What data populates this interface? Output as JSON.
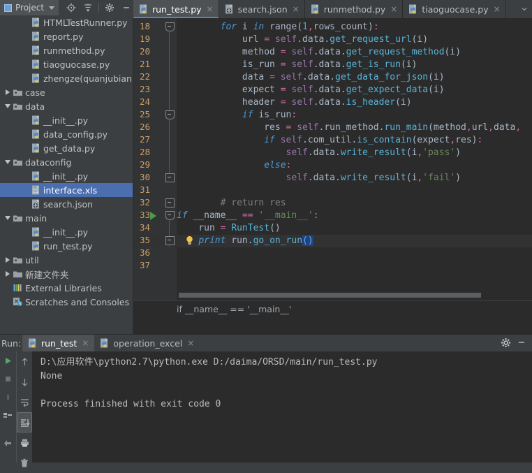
{
  "toolbar": {
    "project_label": "Project",
    "icons": [
      "project-panel-icon",
      "dropdown-caret-icon",
      "locate-target-icon",
      "collapse-all-icon",
      "settings-gear-icon",
      "hide-panel-icon"
    ]
  },
  "tree": {
    "items": [
      {
        "label": "HTMLTestRunner.py",
        "icon": "python-file-icon",
        "indent": 2,
        "arrow": "none",
        "selected": false
      },
      {
        "label": "report.py",
        "icon": "python-file-icon",
        "indent": 2,
        "arrow": "none",
        "selected": false
      },
      {
        "label": "runmethod.py",
        "icon": "python-file-icon",
        "indent": 2,
        "arrow": "none",
        "selected": false
      },
      {
        "label": "tiaoguocase.py",
        "icon": "python-file-icon",
        "indent": 2,
        "arrow": "none",
        "selected": false
      },
      {
        "label": "zhengze(quanjubianliar",
        "icon": "python-file-icon",
        "indent": 2,
        "arrow": "none",
        "selected": false
      },
      {
        "label": "case",
        "icon": "folder-icon",
        "indent": 0,
        "arrow": "closed",
        "selected": false
      },
      {
        "label": "data",
        "icon": "folder-icon",
        "indent": 0,
        "arrow": "open",
        "selected": false
      },
      {
        "label": "__init__.py",
        "icon": "python-file-icon",
        "indent": 2,
        "arrow": "none",
        "selected": false
      },
      {
        "label": "data_config.py",
        "icon": "python-file-icon",
        "indent": 2,
        "arrow": "none",
        "selected": false
      },
      {
        "label": "get_data.py",
        "icon": "python-file-icon",
        "indent": 2,
        "arrow": "none",
        "selected": false
      },
      {
        "label": "dataconfig",
        "icon": "folder-icon",
        "indent": 0,
        "arrow": "open",
        "selected": false
      },
      {
        "label": "__init__.py",
        "icon": "python-file-icon",
        "indent": 2,
        "arrow": "none",
        "selected": false
      },
      {
        "label": "interface.xls",
        "icon": "xls-file-icon",
        "indent": 2,
        "arrow": "none",
        "selected": true
      },
      {
        "label": "search.json",
        "icon": "json-file-icon",
        "indent": 2,
        "arrow": "none",
        "selected": false
      },
      {
        "label": "main",
        "icon": "folder-icon",
        "indent": 0,
        "arrow": "open",
        "selected": false
      },
      {
        "label": "__init__.py",
        "icon": "python-file-icon",
        "indent": 2,
        "arrow": "none",
        "selected": false
      },
      {
        "label": "run_test.py",
        "icon": "python-file-icon",
        "indent": 2,
        "arrow": "none",
        "selected": false
      },
      {
        "label": "util",
        "icon": "folder-icon",
        "indent": 0,
        "arrow": "closed",
        "selected": false
      },
      {
        "label": "新建文件夹",
        "icon": "folder-plain-icon",
        "indent": 0,
        "arrow": "closed",
        "selected": false
      },
      {
        "label": "External Libraries",
        "icon": "libraries-icon",
        "indent": 0,
        "arrow": "none",
        "selected": false
      },
      {
        "label": "Scratches and Consoles",
        "icon": "scratches-icon",
        "indent": 0,
        "arrow": "none",
        "selected": false
      }
    ]
  },
  "editor": {
    "tabs": [
      {
        "label": "run_test.py",
        "icon": "python-file-icon",
        "active": true
      },
      {
        "label": "search.json",
        "icon": "json-file-icon",
        "active": false
      },
      {
        "label": "runmethod.py",
        "icon": "python-file-icon",
        "active": false
      },
      {
        "label": "tiaoguocase.py",
        "icon": "python-file-icon",
        "active": false
      }
    ],
    "close_glyph": "×",
    "breadcrumb": "if __name__ == '__main__'",
    "first_line_number": 18,
    "last_line_number": 37,
    "current_line": 35,
    "lines": [
      {
        "n": 18,
        "tokens": [
          {
            "t": "        ",
            "c": "pl"
          },
          {
            "t": "for",
            "c": "kwi"
          },
          {
            "t": " i ",
            "c": "pl"
          },
          {
            "t": "in",
            "c": "kwi"
          },
          {
            "t": " range(",
            "c": "pl"
          },
          {
            "t": "1",
            "c": "num"
          },
          {
            "t": ",",
            "c": "op"
          },
          {
            "t": "rows_count",
            "c": "pl"
          },
          {
            "t": ")",
            "c": "pl"
          },
          {
            "t": ":",
            "c": "op"
          }
        ]
      },
      {
        "n": 19,
        "tokens": [
          {
            "t": "            url ",
            "c": "pl"
          },
          {
            "t": "=",
            "c": "op"
          },
          {
            "t": " ",
            "c": "pl"
          },
          {
            "t": "self",
            "c": "sf"
          },
          {
            "t": ".data.",
            "c": "pl"
          },
          {
            "t": "get_request_url",
            "c": "fn"
          },
          {
            "t": "(i)",
            "c": "pl"
          }
        ]
      },
      {
        "n": 20,
        "tokens": [
          {
            "t": "            method ",
            "c": "pl"
          },
          {
            "t": "=",
            "c": "op"
          },
          {
            "t": " ",
            "c": "pl"
          },
          {
            "t": "self",
            "c": "sf"
          },
          {
            "t": ".data.",
            "c": "pl"
          },
          {
            "t": "get_request_method",
            "c": "fn"
          },
          {
            "t": "(i)",
            "c": "pl"
          }
        ]
      },
      {
        "n": 21,
        "tokens": [
          {
            "t": "            is_run ",
            "c": "pl"
          },
          {
            "t": "=",
            "c": "op"
          },
          {
            "t": " ",
            "c": "pl"
          },
          {
            "t": "self",
            "c": "sf"
          },
          {
            "t": ".data.",
            "c": "pl"
          },
          {
            "t": "get_is_run",
            "c": "fn"
          },
          {
            "t": "(i)",
            "c": "pl"
          }
        ]
      },
      {
        "n": 22,
        "tokens": [
          {
            "t": "            data ",
            "c": "pl"
          },
          {
            "t": "=",
            "c": "op"
          },
          {
            "t": " ",
            "c": "pl"
          },
          {
            "t": "self",
            "c": "sf"
          },
          {
            "t": ".data.",
            "c": "pl"
          },
          {
            "t": "get_data_for_json",
            "c": "fn"
          },
          {
            "t": "(i)",
            "c": "pl"
          }
        ]
      },
      {
        "n": 23,
        "tokens": [
          {
            "t": "            expect ",
            "c": "pl"
          },
          {
            "t": "=",
            "c": "op"
          },
          {
            "t": " ",
            "c": "pl"
          },
          {
            "t": "self",
            "c": "sf"
          },
          {
            "t": ".data.",
            "c": "pl"
          },
          {
            "t": "get_expect_data",
            "c": "fn"
          },
          {
            "t": "(i)",
            "c": "pl"
          }
        ]
      },
      {
        "n": 24,
        "tokens": [
          {
            "t": "            header ",
            "c": "pl"
          },
          {
            "t": "=",
            "c": "op"
          },
          {
            "t": " ",
            "c": "pl"
          },
          {
            "t": "self",
            "c": "sf"
          },
          {
            "t": ".data.",
            "c": "pl"
          },
          {
            "t": "is_header",
            "c": "fn"
          },
          {
            "t": "(i)",
            "c": "pl"
          }
        ]
      },
      {
        "n": 25,
        "tokens": [
          {
            "t": "            ",
            "c": "pl"
          },
          {
            "t": "if",
            "c": "kwi"
          },
          {
            "t": " is_run",
            "c": "pl"
          },
          {
            "t": ":",
            "c": "op"
          }
        ]
      },
      {
        "n": 26,
        "tokens": [
          {
            "t": "                res ",
            "c": "pl"
          },
          {
            "t": "=",
            "c": "op"
          },
          {
            "t": " ",
            "c": "pl"
          },
          {
            "t": "self",
            "c": "sf"
          },
          {
            "t": ".run_method.",
            "c": "pl"
          },
          {
            "t": "run_main",
            "c": "fn"
          },
          {
            "t": "(method",
            "c": "pl"
          },
          {
            "t": ",",
            "c": "op"
          },
          {
            "t": "url",
            "c": "pl"
          },
          {
            "t": ",",
            "c": "op"
          },
          {
            "t": "data",
            "c": "pl"
          },
          {
            "t": ",",
            "c": "op"
          }
        ]
      },
      {
        "n": 27,
        "tokens": [
          {
            "t": "                ",
            "c": "pl"
          },
          {
            "t": "if",
            "c": "kwi"
          },
          {
            "t": " ",
            "c": "pl"
          },
          {
            "t": "self",
            "c": "sf"
          },
          {
            "t": ".com_util.",
            "c": "pl"
          },
          {
            "t": "is_contain",
            "c": "fn"
          },
          {
            "t": "(expect",
            "c": "pl"
          },
          {
            "t": ",",
            "c": "op"
          },
          {
            "t": "res)",
            "c": "pl"
          },
          {
            "t": ":",
            "c": "op"
          }
        ]
      },
      {
        "n": 28,
        "tokens": [
          {
            "t": "                    ",
            "c": "pl"
          },
          {
            "t": "self",
            "c": "sf"
          },
          {
            "t": ".data.",
            "c": "pl"
          },
          {
            "t": "write_result",
            "c": "fn"
          },
          {
            "t": "(i",
            "c": "pl"
          },
          {
            "t": ",",
            "c": "op"
          },
          {
            "t": "'pass'",
            "c": "str"
          },
          {
            "t": ")",
            "c": "pl"
          }
        ]
      },
      {
        "n": 29,
        "tokens": [
          {
            "t": "                ",
            "c": "pl"
          },
          {
            "t": "else",
            "c": "kwi"
          },
          {
            "t": ":",
            "c": "op"
          }
        ]
      },
      {
        "n": 30,
        "tokens": [
          {
            "t": "                    ",
            "c": "pl"
          },
          {
            "t": "self",
            "c": "sf"
          },
          {
            "t": ".data.",
            "c": "pl"
          },
          {
            "t": "write_result",
            "c": "fn"
          },
          {
            "t": "(i",
            "c": "pl"
          },
          {
            "t": ",",
            "c": "op"
          },
          {
            "t": "'fail'",
            "c": "str"
          },
          {
            "t": ")",
            "c": "pl"
          }
        ]
      },
      {
        "n": 31,
        "tokens": []
      },
      {
        "n": 32,
        "tokens": [
          {
            "t": "        ",
            "c": "pl"
          },
          {
            "t": "# return res",
            "c": "cmt"
          }
        ]
      },
      {
        "n": 33,
        "tokens": [
          {
            "t": "if",
            "c": "kwi"
          },
          {
            "t": " __name__ ",
            "c": "pl"
          },
          {
            "t": "==",
            "c": "op"
          },
          {
            "t": " ",
            "c": "pl"
          },
          {
            "t": "'__main__'",
            "c": "str"
          },
          {
            "t": ":",
            "c": "op"
          }
        ]
      },
      {
        "n": 34,
        "tokens": [
          {
            "t": "    run ",
            "c": "pl"
          },
          {
            "t": "=",
            "c": "op"
          },
          {
            "t": " ",
            "c": "pl"
          },
          {
            "t": "RunTest",
            "c": "fn"
          },
          {
            "t": "()",
            "c": "pl"
          }
        ]
      },
      {
        "n": 35,
        "tokens": [
          {
            "t": "    ",
            "c": "pl"
          },
          {
            "t": "print",
            "c": "kwi"
          },
          {
            "t": " run.",
            "c": "pl"
          },
          {
            "t": "go_on_run",
            "c": "fn"
          },
          {
            "t": "()",
            "c": "sel"
          }
        ]
      },
      {
        "n": 36,
        "tokens": []
      },
      {
        "n": 37,
        "tokens": []
      }
    ]
  },
  "run_panel": {
    "title": "Run:",
    "tabs": [
      {
        "label": "run_test",
        "icon": "python-file-icon",
        "active": true
      },
      {
        "label": "operation_excel",
        "icon": "python-file-icon",
        "active": false
      }
    ],
    "close_glyph": "×",
    "left_icons": [
      "run-play-icon",
      "stop-icon",
      "pause-icon",
      "layout-icon",
      "pin-icon"
    ],
    "mid_icons": [
      "scroll-up-icon",
      "scroll-down-icon",
      "soft-wrap-icon",
      "scroll-to-end-icon",
      "print-icon",
      "trash-icon"
    ],
    "right_icons": [
      "settings-gear-icon",
      "hide-panel-icon"
    ],
    "console_lines": [
      "D:\\应用软件\\python2.7\\python.exe D:/daima/ORSD/main/run_test.py",
      "None",
      "",
      "Process finished with exit code 0"
    ]
  },
  "colors": {
    "accent": "#4b6eaf",
    "tab_underline": "#4a88c7",
    "editor_bg": "#2b2b2b",
    "panel_bg": "#3c3f41",
    "line_number": "#cd9f65",
    "keyword": "#cc7832",
    "string": "#6a8759",
    "function": "#59b3d8",
    "self": "#9876aa",
    "number": "#6897bb",
    "comment": "#808080",
    "selection": "#214283"
  }
}
